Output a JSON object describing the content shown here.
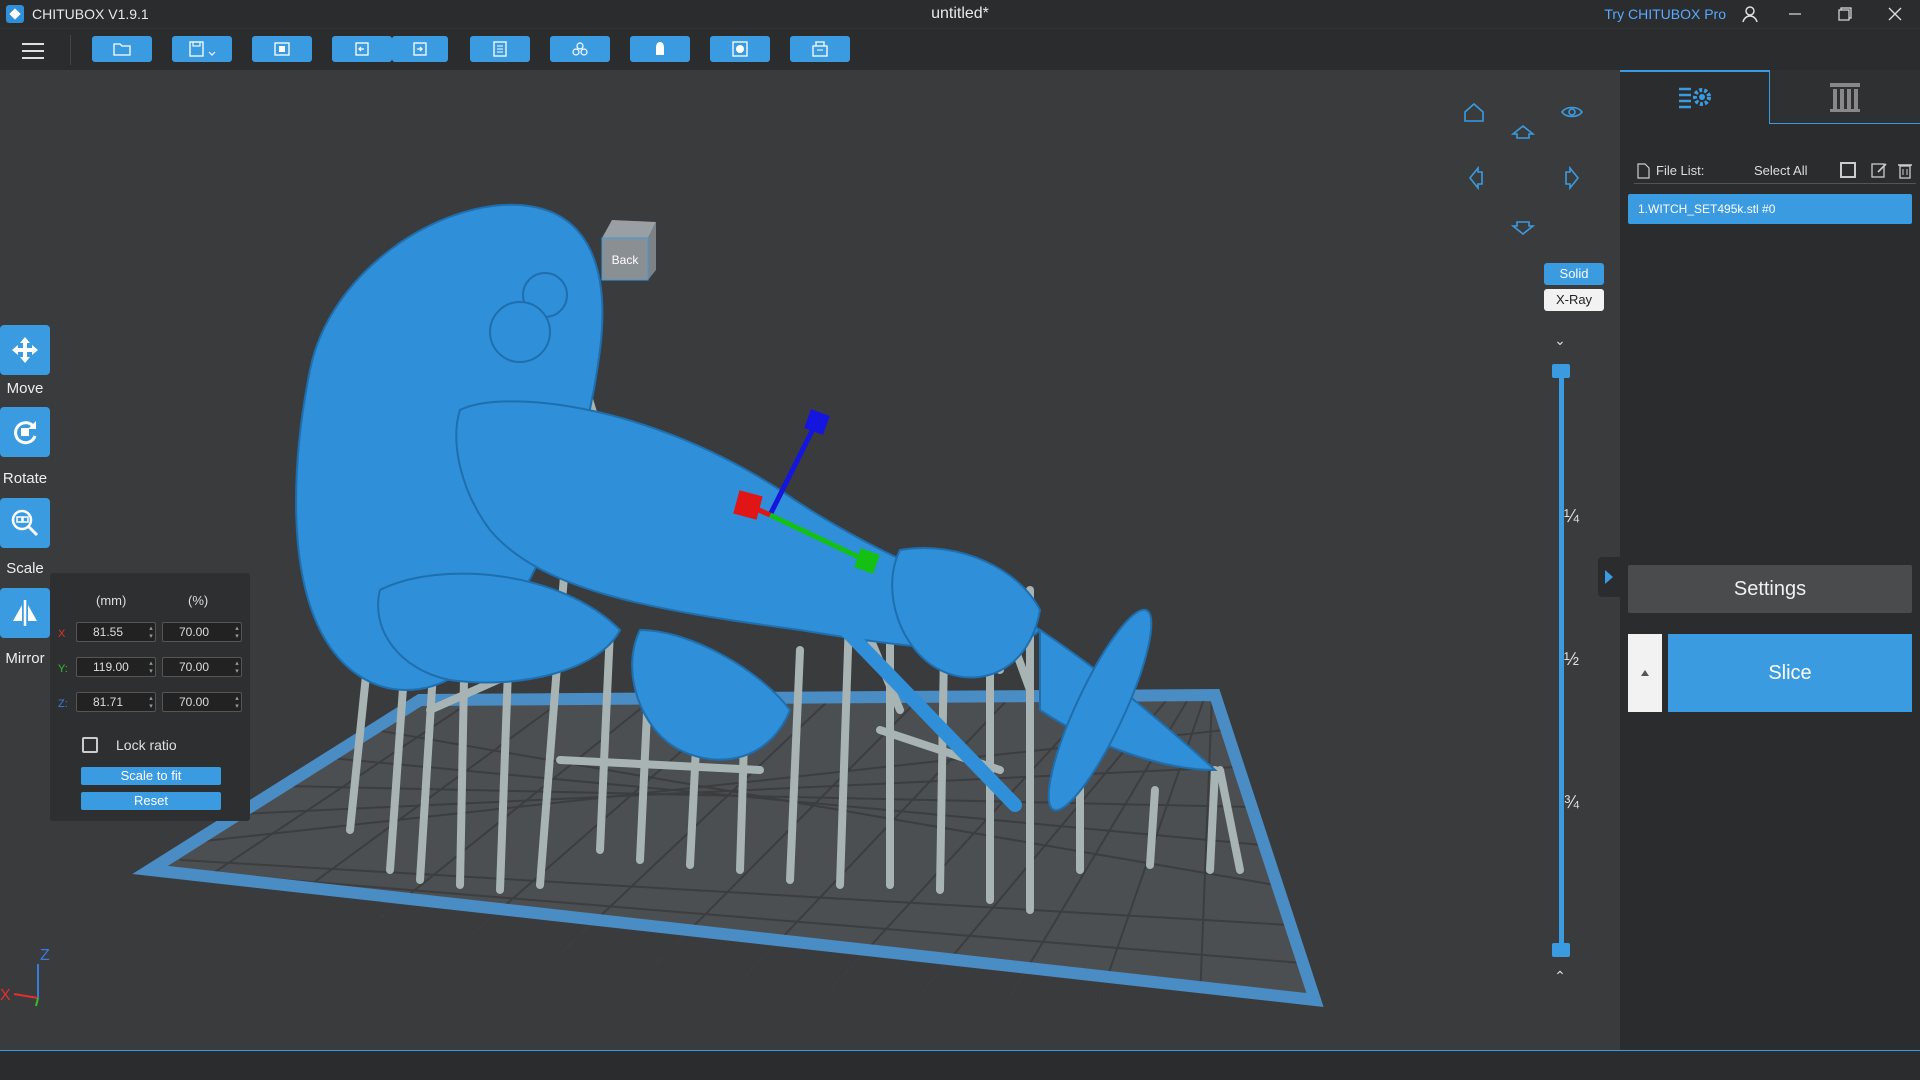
{
  "titlebar": {
    "app_name": "CHITUBOX V1.9.1",
    "document_title": "untitled*",
    "try_pro": "Try CHITUBOX Pro"
  },
  "toolbar": {
    "buttons": [
      "open-file-icon",
      "save-icon",
      "import-icon",
      "undo-icon",
      "redo-icon",
      "list-icon",
      "arrange-icon",
      "support-icon",
      "hollow-icon",
      "print-icon"
    ]
  },
  "tools": {
    "move": "Move",
    "rotate": "Rotate",
    "scale": "Scale",
    "mirror": "Mirror"
  },
  "scale_panel": {
    "col_mm": "(mm)",
    "col_pct": "(%)",
    "x_label": "X",
    "y_label": "Y:",
    "z_label": "Z:",
    "x_mm": "81.55",
    "x_pct": "70.00",
    "y_mm": "119.00",
    "y_pct": "70.00",
    "z_mm": "81.71",
    "z_pct": "70.00",
    "lock_ratio": "Lock ratio",
    "scale_to_fit": "Scale to fit",
    "reset": "Reset"
  },
  "view": {
    "cube_face": "Back",
    "solid": "Solid",
    "xray": "X-Ray",
    "fractions": [
      "¼",
      "½",
      "¾"
    ]
  },
  "axis_indicator": {
    "z": "Z",
    "x": "X"
  },
  "right_panel": {
    "file_list_label": "File List:",
    "select_all": "Select All",
    "file_item": "1.WITCH_SET495k.stl #0",
    "settings": "Settings",
    "slice": "Slice"
  },
  "colors": {
    "accent": "#3a9be0",
    "background": "#3a3b3d",
    "panel": "#2b2c2e",
    "model": "#2f8fd8",
    "supports": "#a8b4b4"
  }
}
